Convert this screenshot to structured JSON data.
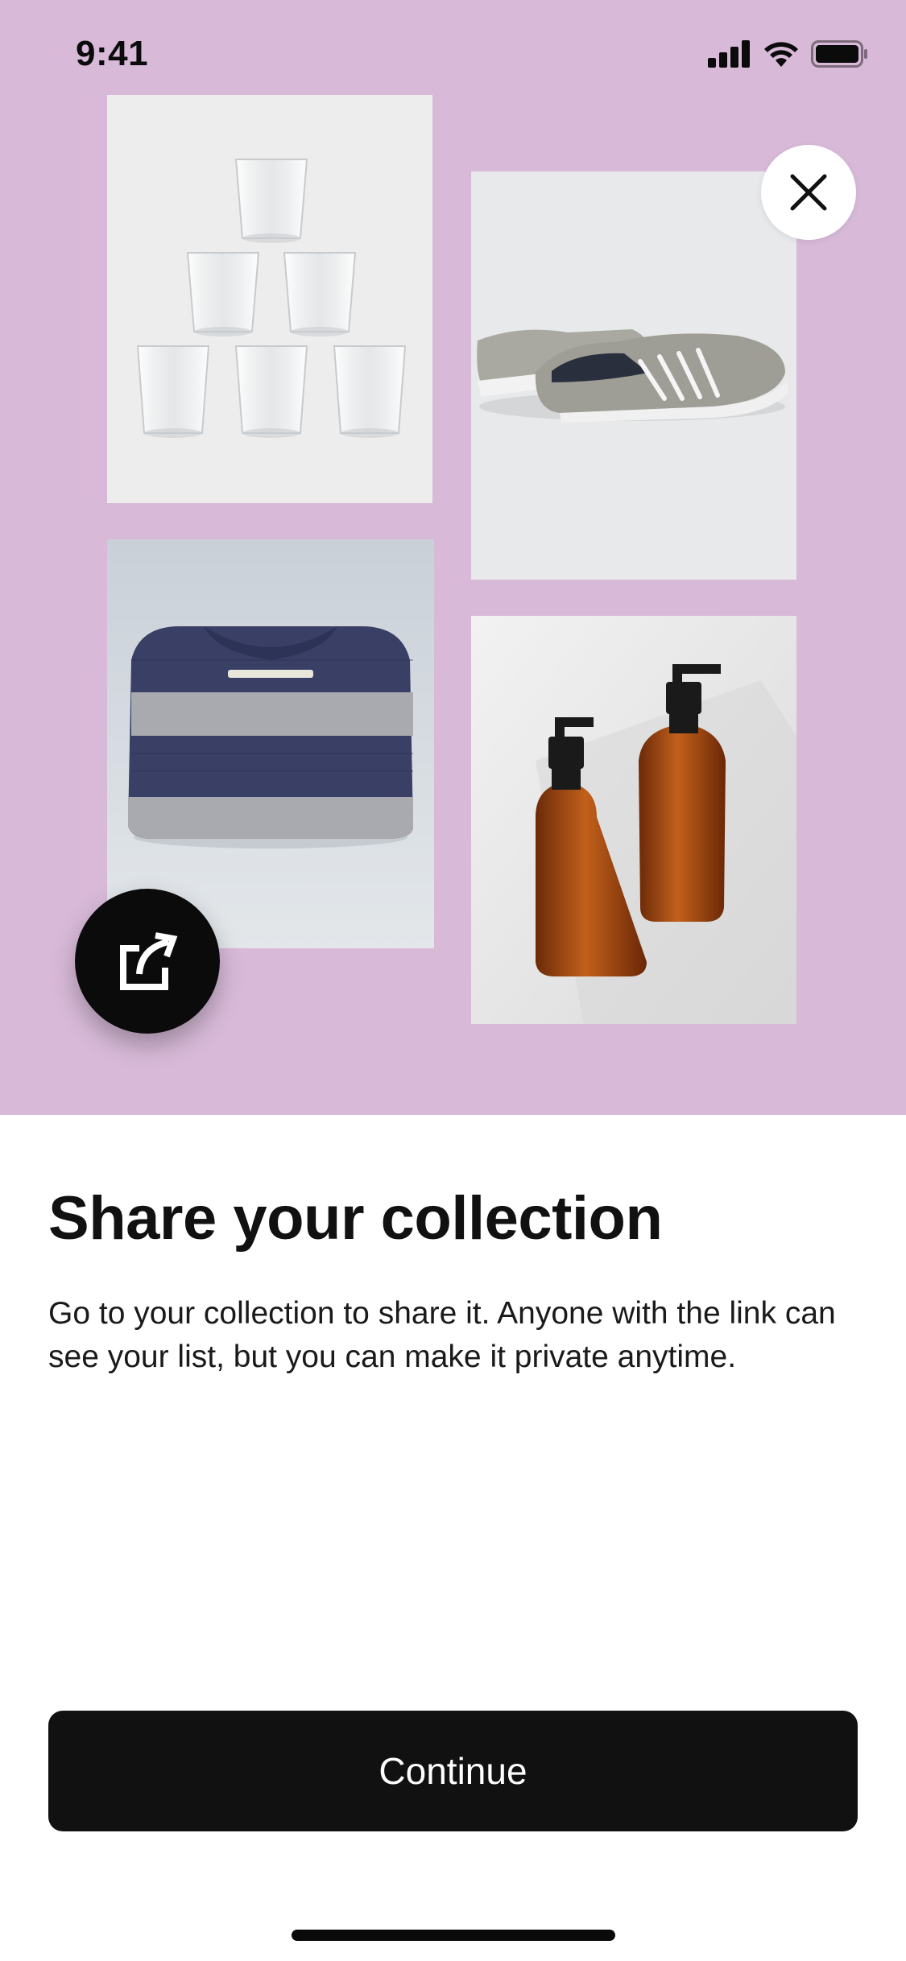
{
  "status_bar": {
    "time": "9:41",
    "icons": [
      "cellular-signal-icon",
      "wifi-icon",
      "battery-icon"
    ]
  },
  "hero": {
    "background": "#d8bad8",
    "tiles": [
      {
        "name": "glasses-tile",
        "subject": "stacked drinking glasses"
      },
      {
        "name": "shoes-tile",
        "subject": "grey sneakers"
      },
      {
        "name": "sweater-tile",
        "subject": "striped knit sweater"
      },
      {
        "name": "bottles-tile",
        "subject": "amber pump bottles"
      }
    ],
    "close_icon": "close-icon",
    "share_icon": "share-icon"
  },
  "content": {
    "title": "Share your collection",
    "description": "Go to your collection to share it. Anyone with the link can see your list, but you can make it private anytime."
  },
  "actions": {
    "continue_label": "Continue"
  },
  "colors": {
    "accent": "#111111",
    "hero_bg": "#d8bad8",
    "background": "#ffffff"
  }
}
